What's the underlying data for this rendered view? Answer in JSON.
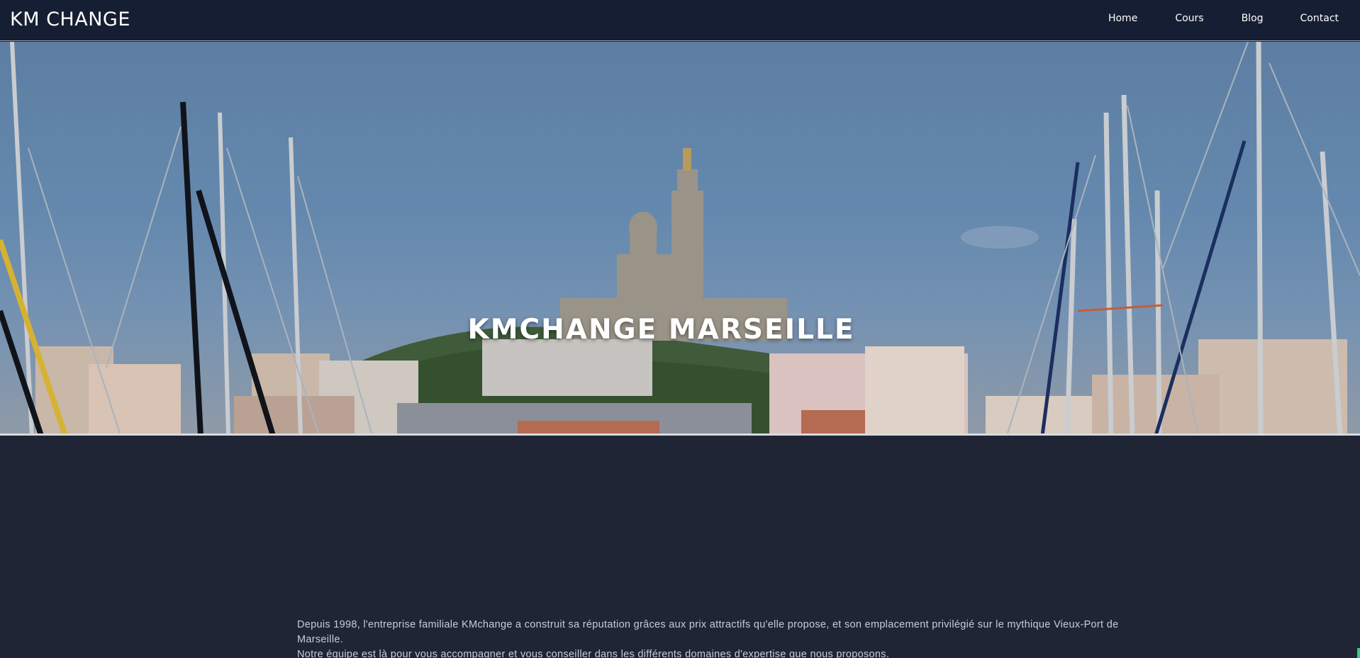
{
  "navbar": {
    "brand": "KM CHANGE",
    "links": [
      "Home",
      "Cours",
      "Blog",
      "Contact"
    ]
  },
  "hero": {
    "title": "KMCHANGE MARSEILLE"
  },
  "intro": {
    "line1": "Depuis 1998, l'entreprise familiale KMchange a construit sa réputation grâces aux prix attractifs qu'elle propose, et son emplacement privilégié sur le mythique Vieux-Port de Marseille.",
    "line2": "Notre équipe est là pour vous accompagner et vous conseiller dans les différents domaines d'expertise que nous proposons."
  }
}
